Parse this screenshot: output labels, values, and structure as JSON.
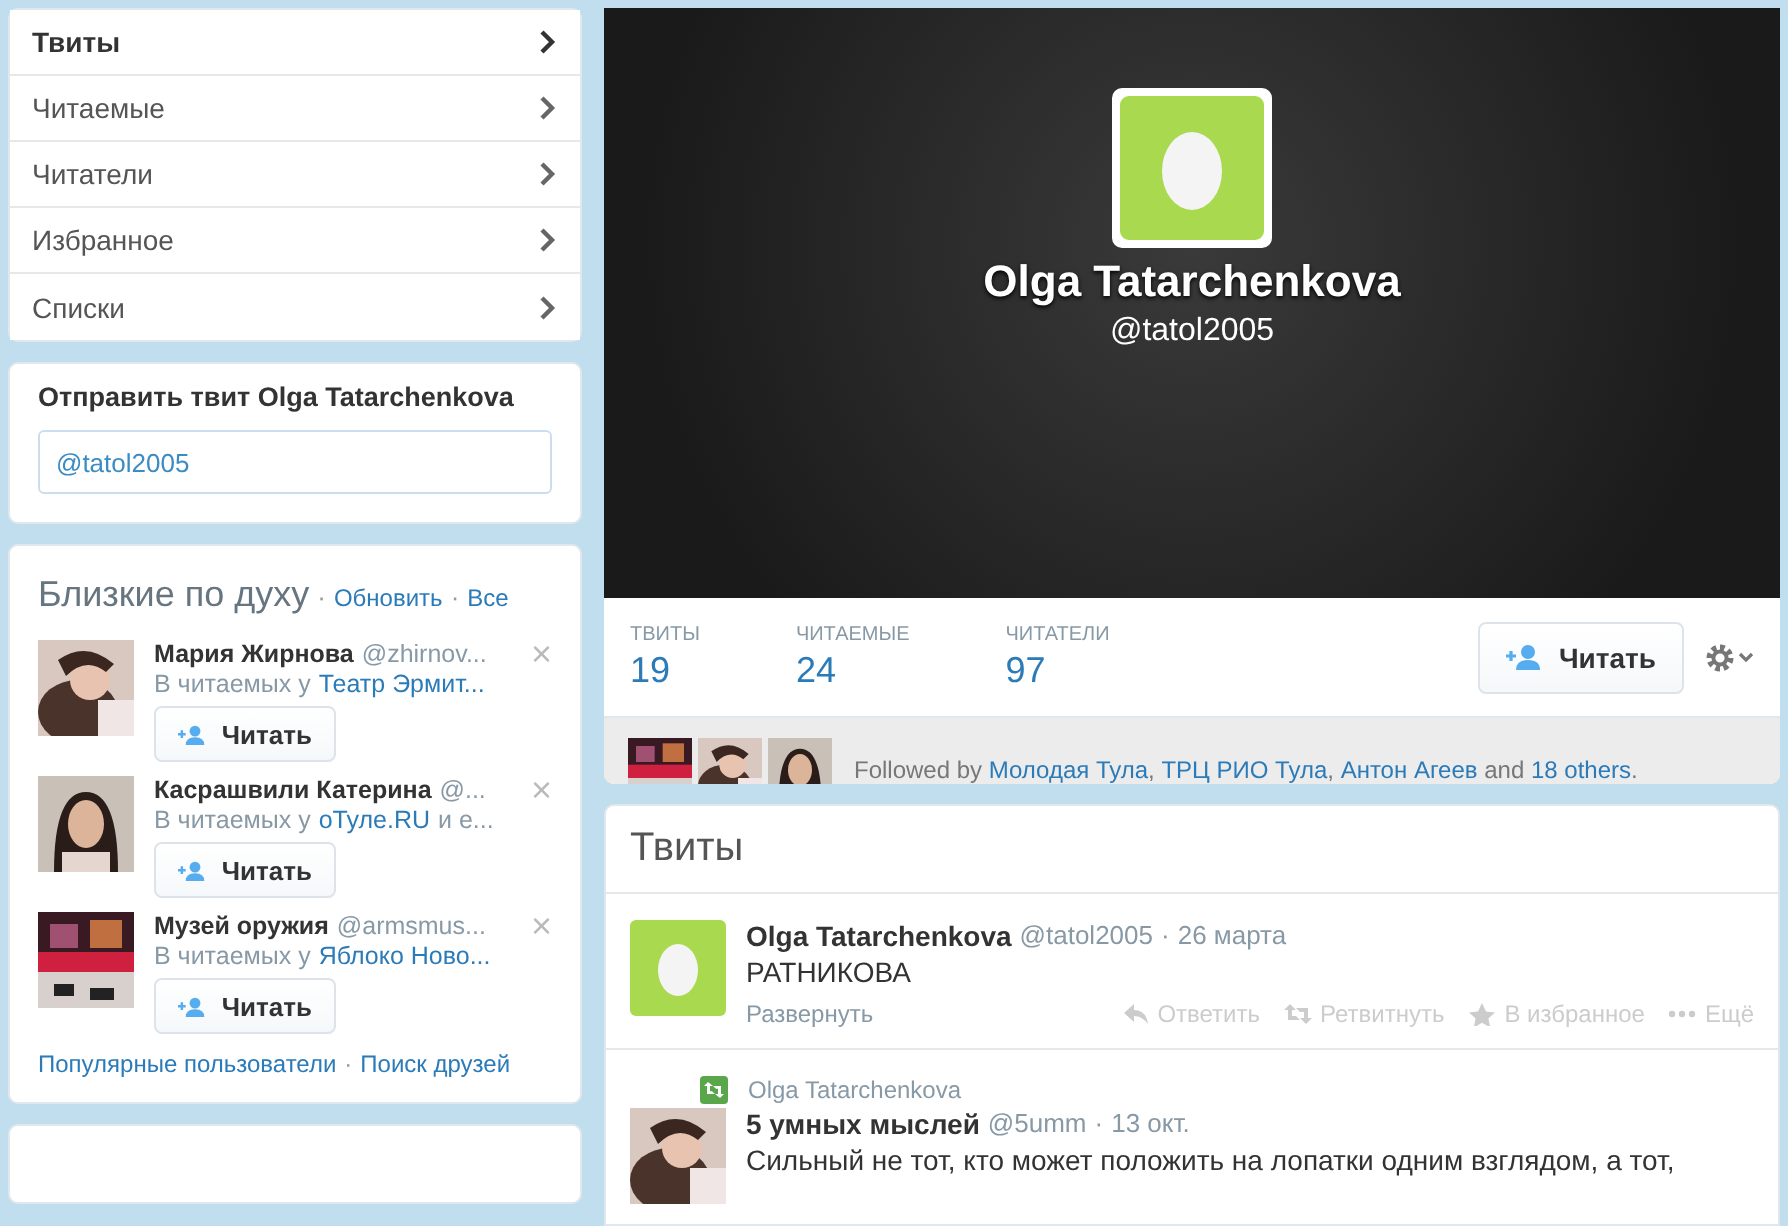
{
  "nav": [
    {
      "label": "Твиты",
      "selected": true
    },
    {
      "label": "Читаемые",
      "selected": false
    },
    {
      "label": "Читатели",
      "selected": false
    },
    {
      "label": "Избранное",
      "selected": false
    },
    {
      "label": "Списки",
      "selected": false
    }
  ],
  "tweet_to": {
    "title": "Отправить твит Olga Tatarchenkova",
    "value": "@tatol2005"
  },
  "who_to_follow": {
    "separator": "·",
    "title": "Близкие по духу",
    "refresh": "Обновить",
    "all": "Все",
    "users": [
      {
        "name": "Мария Жирнова",
        "handle": "@zhirnov...",
        "context": "В читаемых у",
        "context_link": "Театр Эрмит...",
        "follow": "Читать",
        "close": "×"
      },
      {
        "name": "Касрашвили Катерина",
        "handle": "@...",
        "context": "В читаемых у",
        "context_link": "оТуле.RU",
        "context_rest": "и е...",
        "follow": "Читать",
        "close": "×"
      },
      {
        "name": "Музей оружия",
        "handle": "@armsmus...",
        "context": "В читаемых у",
        "context_link": "Яблоко Ново...",
        "follow": "Читать",
        "close": "×"
      }
    ],
    "popular": "Популярные пользователи",
    "find": "Поиск друзей"
  },
  "profile": {
    "name": "Olga Tatarchenkova",
    "handle": "@tatol2005"
  },
  "stats": [
    {
      "label": "ТВИТЫ",
      "value": "19"
    },
    {
      "label": "ЧИТАЕМЫЕ",
      "value": "24"
    },
    {
      "label": "ЧИТАТЕЛИ",
      "value": "97"
    }
  ],
  "follow_button": "Читать",
  "followed_by": {
    "separator": ",",
    "prefix": "Followed by",
    "links": [
      "Молодая Тула",
      "ТРЦ РИО Тула",
      "Антон Агеев"
    ],
    "and": "and",
    "others": "18 others",
    "end": "."
  },
  "timeline": {
    "separator": "·",
    "title": "Твиты",
    "tweets": [
      {
        "kind": "tweet",
        "name": "Olga Tatarchenkova",
        "handle": "@tatol2005",
        "time": "26 марта",
        "text": "РАТНИКОВА",
        "expand": "Развернуть",
        "actions": [
          "Ответить",
          "Ретвитнуть",
          "В избранное",
          "Ещё"
        ]
      },
      {
        "kind": "retweet",
        "retweeted_by": "Olga Tatarchenkova",
        "name": "5 умных мыслей",
        "handle": "@5umm",
        "time": "13 окт.",
        "text": "Сильный не тот, кто может положить на лопатки одним взглядом, а тот,"
      }
    ]
  }
}
